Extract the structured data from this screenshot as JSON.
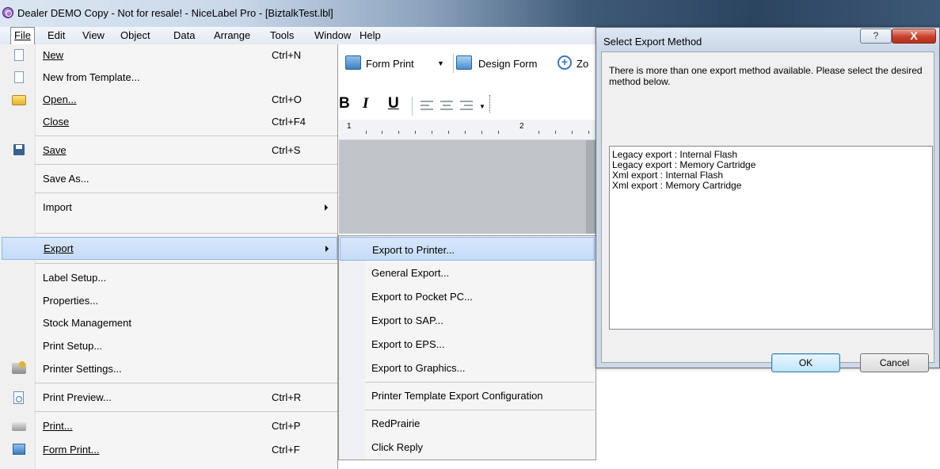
{
  "window": {
    "title": "Dealer DEMO Copy - Not for resale! - NiceLabel Pro - [BiztalkTest.lbl]"
  },
  "menubar": {
    "items": [
      "File",
      "Edit",
      "View",
      "Object",
      "Data",
      "Arrange",
      "Tools",
      "Window",
      "Help"
    ]
  },
  "toolbar": {
    "form_print": "Form Print",
    "design_form": "Design Form",
    "zoom_partial": "Zo"
  },
  "format_toolbar": {
    "bold": "B",
    "italic": "I",
    "underline": "U"
  },
  "ruler": {
    "marks": [
      "1",
      "2"
    ]
  },
  "file_menu": {
    "items": [
      {
        "label": "New",
        "shortcut": "Ctrl+N",
        "icon": "new-document-icon"
      },
      {
        "label": "New from Template...",
        "shortcut": "",
        "icon": "template-icon"
      },
      {
        "label": "Open...",
        "shortcut": "Ctrl+O",
        "icon": "open-folder-icon"
      },
      {
        "label": "Close",
        "shortcut": "Ctrl+F4",
        "icon": ""
      },
      {
        "label": "Save",
        "shortcut": "Ctrl+S",
        "icon": "save-disk-icon"
      },
      {
        "label": "Save As...",
        "shortcut": "",
        "icon": ""
      },
      {
        "label": "Import",
        "shortcut": "",
        "icon": ""
      },
      {
        "label": "Export",
        "shortcut": "",
        "icon": ""
      },
      {
        "label": "Label Setup...",
        "shortcut": "",
        "icon": ""
      },
      {
        "label": "Properties...",
        "shortcut": "",
        "icon": ""
      },
      {
        "label": "Stock Management",
        "shortcut": "",
        "icon": ""
      },
      {
        "label": "Print Setup...",
        "shortcut": "",
        "icon": ""
      },
      {
        "label": "Printer Settings...",
        "shortcut": "",
        "icon": "printer-settings-icon"
      },
      {
        "label": "Print Preview...",
        "shortcut": "Ctrl+R",
        "icon": "print-preview-icon"
      },
      {
        "label": "Print...",
        "shortcut": "Ctrl+P",
        "icon": "printer-icon"
      },
      {
        "label": "Form Print...",
        "shortcut": "Ctrl+F",
        "icon": "form-print-icon"
      }
    ]
  },
  "export_menu": {
    "items": [
      "Export to Printer...",
      "General Export...",
      "Export to Pocket PC...",
      "Export to SAP...",
      "Export to EPS...",
      "Export to Graphics...",
      "Printer Template Export Configuration",
      "RedPrairie",
      "Click Reply"
    ]
  },
  "dialog": {
    "title": "Select Export Method",
    "help_label": "?",
    "close_label": "X",
    "message": "There is more than one export method available. Please select the desired method below.",
    "methods": [
      "Legacy export : Internal Flash",
      "Legacy export : Memory Cartridge",
      "Xml export : Internal Flash",
      "Xml export : Memory Cartridge"
    ],
    "ok_label": "OK",
    "cancel_label": "Cancel"
  }
}
